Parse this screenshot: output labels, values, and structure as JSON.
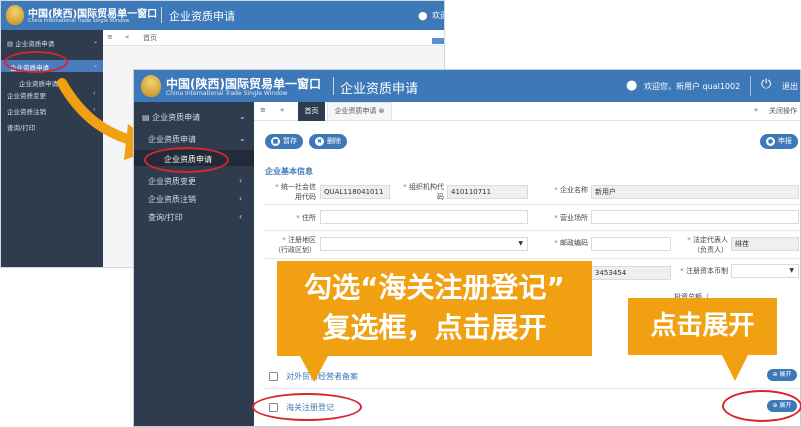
{
  "back_window": {
    "header": {
      "title_cn": "中国(陕西)国际贸易单一窗口",
      "title_en": "China International Trade Single Window",
      "page_title": "企业资质申请",
      "welcome": "欢迎"
    },
    "sidebar": {
      "group": "企业资质申请",
      "items": [
        "企业资质申请",
        "企业资质申请",
        "企业资质变更",
        "企业资质注销",
        "查询/打印"
      ]
    },
    "tabs": {
      "home": "首页"
    }
  },
  "front_window": {
    "header": {
      "title_cn": "中国(陕西)国际贸易单一窗口",
      "title_en": "China International Trade Single Window",
      "page_title": "企业资质申请",
      "welcome": "欢迎您，新用户 qual1002",
      "logout": "退出"
    },
    "sidebar": {
      "group": "企业资质申请",
      "items": [
        "企业资质申请",
        "企业资质申请",
        "企业资质变更",
        "企业资质注销",
        "查询/打印"
      ]
    },
    "tabs": {
      "home": "首页",
      "current": "企业资质申请",
      "close_all": "关闭操作"
    },
    "toolbar": {
      "save": "暂存",
      "delete": "删除",
      "submit": "申报"
    },
    "section_title": "企业基本信息",
    "fields": {
      "credit_code_label_1": "统一社会信",
      "credit_code_label_2": "用代码",
      "credit_code_value": "QUAL118041011",
      "org_code_label_1": "组织机构代",
      "org_code_label_2": "码",
      "org_code_value": "410110711",
      "company_name_label": "企业名称",
      "company_name_value": "新用户",
      "address_label": "住所",
      "business_addr_label": "营业场所",
      "district_label_1": "注册地区",
      "district_label_2": "（行政区划）",
      "postcode_label": "邮政编码",
      "legal_rep_label_1": "法定代表人",
      "legal_rep_label_2": "（负责人）",
      "legal_rep_value": "绯荏",
      "phone_value": "3453454",
      "registered_capital_label": "注册资本币制",
      "partial_label": "投资总额（"
    },
    "checkbox_rows": [
      {
        "label": "对外贸易经营者备案",
        "expand": "展开"
      },
      {
        "label": "海关注册登记",
        "expand": "展开"
      }
    ]
  },
  "annotations": {
    "callout_main_line1": "勾选“海关注册登记”",
    "callout_main_line2": "复选框，点击展开",
    "callout_expand": "点击展开"
  }
}
